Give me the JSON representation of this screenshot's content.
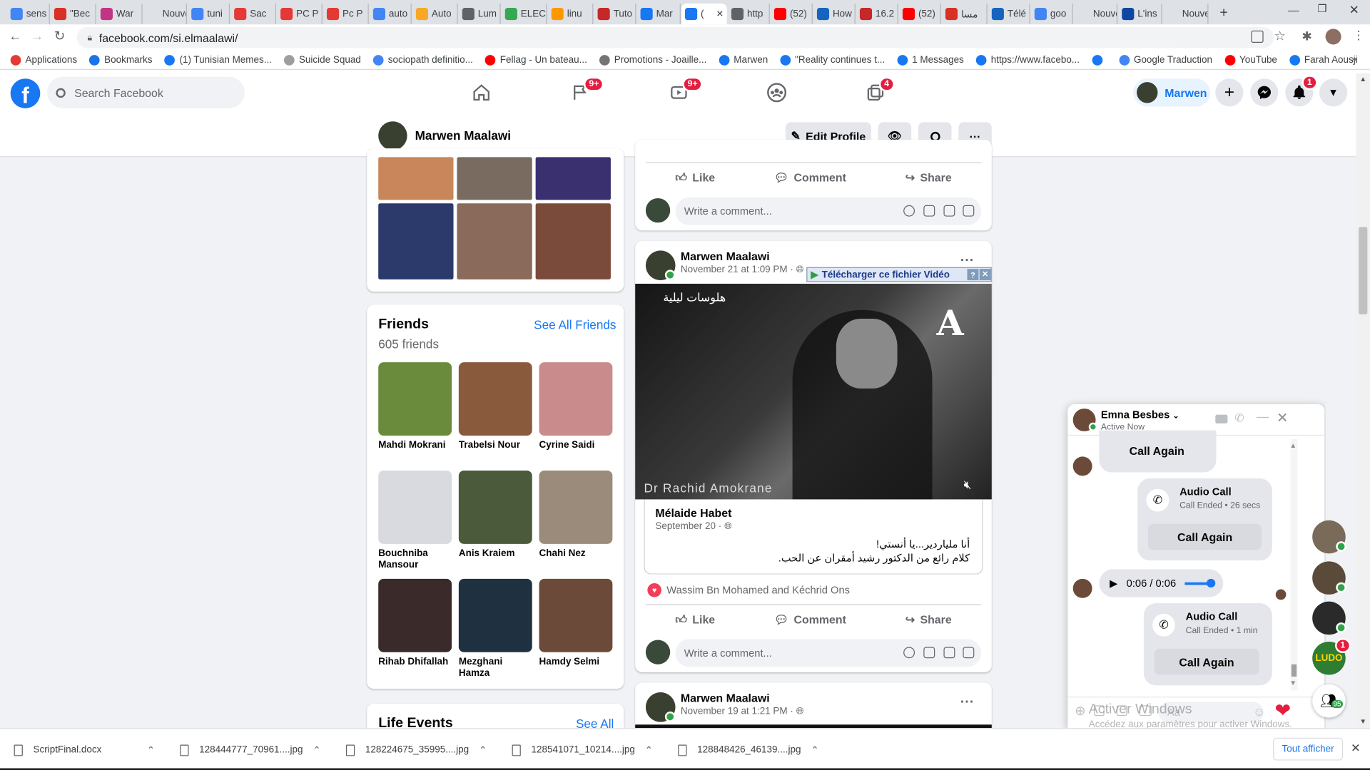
{
  "browser": {
    "tabs": [
      {
        "label": "sens",
        "icon": "google-icon",
        "color": "#4285f4"
      },
      {
        "label": "\"Bec",
        "icon": "heart-icon",
        "color": "#d93025"
      },
      {
        "label": "War",
        "icon": "instagram-icon",
        "color": "#c13584"
      },
      {
        "label": "Nouvel o",
        "icon": "none",
        "color": "#dee1e6"
      },
      {
        "label": "tuni",
        "icon": "google-icon",
        "color": "#4285f4"
      },
      {
        "label": "Sac",
        "icon": "avito-icon",
        "color": "#e53935"
      },
      {
        "label": "PC P",
        "icon": "avito-icon",
        "color": "#e53935"
      },
      {
        "label": "Pc P",
        "icon": "avito-icon",
        "color": "#e53935"
      },
      {
        "label": "auto",
        "icon": "google-icon",
        "color": "#4285f4"
      },
      {
        "label": "Auto",
        "icon": "chart-icon",
        "color": "#f9a825"
      },
      {
        "label": "Lum",
        "icon": "globe-icon",
        "color": "#5f6368"
      },
      {
        "label": "ELEC",
        "icon": "maps-icon",
        "color": "#34a853"
      },
      {
        "label": "linu",
        "icon": "page-icon",
        "color": "#ff9800"
      },
      {
        "label": "Tuto",
        "icon": "page-icon",
        "color": "#c62828"
      },
      {
        "label": "Mar",
        "icon": "facebook-icon",
        "color": "#1877f2"
      },
      {
        "label": "(",
        "icon": "facebook-icon",
        "color": "#1877f2"
      },
      {
        "label": "http",
        "icon": "globe-icon",
        "color": "#5f6368"
      },
      {
        "label": "(52)",
        "icon": "youtube-icon",
        "color": "#ff0000"
      },
      {
        "label": "How",
        "icon": "globe-icon",
        "color": "#1565c0"
      },
      {
        "label": "16.2",
        "icon": "cloud-icon",
        "color": "#c62828"
      },
      {
        "label": "(52)",
        "icon": "youtube-icon",
        "color": "#ff0000"
      },
      {
        "label": "مسا",
        "icon": "mail-icon",
        "color": "#d93025"
      },
      {
        "label": "Télé",
        "icon": "download-icon",
        "color": "#1565c0"
      },
      {
        "label": "goo",
        "icon": "google-icon",
        "color": "#4285f4"
      },
      {
        "label": "Nouvel o",
        "icon": "none",
        "color": "#dee1e6"
      },
      {
        "label": "L'ins",
        "icon": "globe-icon",
        "color": "#0d47a1"
      },
      {
        "label": "Nouvel o",
        "icon": "none",
        "color": "#dee1e6"
      }
    ],
    "url": "facebook.com/si.elmaalawi/",
    "bookmarks": [
      {
        "label": "Applications",
        "color": "#e53935"
      },
      {
        "label": "Bookmarks",
        "color": "#1a73e8"
      },
      {
        "label": "(1) Tunisian Memes...",
        "color": "#1877f2"
      },
      {
        "label": "Suicide Squad",
        "color": "#9e9e9e"
      },
      {
        "label": "sociopath definitio...",
        "color": "#4285f4"
      },
      {
        "label": "Fellag - Un bateau...",
        "color": "#ff0000"
      },
      {
        "label": "Promotions - Joaille...",
        "color": "#757575"
      },
      {
        "label": "Marwen",
        "color": "#1877f2"
      },
      {
        "label": "\"Reality continues t...",
        "color": "#1877f2"
      },
      {
        "label": "1 Messages",
        "color": "#1877f2"
      },
      {
        "label": "https://www.facebo...",
        "color": "#1877f2"
      },
      {
        "label": "",
        "color": "#1877f2"
      },
      {
        "label": "Google Traduction",
        "color": "#4285f4"
      },
      {
        "label": "YouTube",
        "color": "#ff0000"
      },
      {
        "label": "Farah Aousji",
        "color": "#1877f2"
      }
    ]
  },
  "header": {
    "search_placeholder": "Search Facebook",
    "badges": {
      "pages": "9+",
      "watch": "9+",
      "gaming": "4",
      "notifications": "1"
    },
    "profile_name": "Marwen"
  },
  "profile_bar": {
    "name": "Marwen Maalawi",
    "edit_label": "Edit Profile"
  },
  "friends": {
    "title": "Friends",
    "see_all": "See All Friends",
    "count": "605 friends",
    "list": [
      {
        "name": "Mahdi Mokrani",
        "color": "#6a8b3c"
      },
      {
        "name": "Trabelsi Nour",
        "color": "#8a5a3c"
      },
      {
        "name": "Cyrine Saidi",
        "color": "#c98b8b"
      },
      {
        "name": "Bouchniba Mansour",
        "color": "#d8dadf"
      },
      {
        "name": "Anis Kraiem",
        "color": "#4a5a3a"
      },
      {
        "name": "Chahi Nez",
        "color": "#9a8b7a"
      },
      {
        "name": "Rihab Dhifallah",
        "color": "#3a2a2a"
      },
      {
        "name": "Mezghani Hamza",
        "color": "#1f3040"
      },
      {
        "name": "Hamdy Selmi",
        "color": "#6b4a3a"
      }
    ]
  },
  "life_events": {
    "title": "Life Events",
    "see_all": "See All"
  },
  "actions": {
    "like": "Like",
    "comment": "Comment",
    "share": "Share",
    "write_comment": "Write a comment..."
  },
  "post1": {
    "author": "Marwen Maalawi",
    "date": "November 21 at 1:09 PM · ",
    "download_overlay": "Télécharger ce fichier Vidéo",
    "video_caption_ar": "هلوسات ليلية",
    "video_name": "Dr  Rachid Amokrane",
    "shared_author": "Mélaide Habet",
    "shared_date": "September 20 · ",
    "shared_line1": "أنا ملياردير...يا أنستي!",
    "shared_line2": "كلام رائع من  الدكتور رشيد أمقران عن الحب.",
    "reactions": "Wassim Bn Mohamed and Kéchrid Ons"
  },
  "post2": {
    "author": "Marwen Maalawi",
    "date": "November 19 at 1:21 PM · "
  },
  "messenger": {
    "name": "Emna Besbes",
    "status": "Active Now",
    "call_again": "Call Again",
    "call1_title": "Audio Call",
    "call1_sub": "Call Ended • 26 secs",
    "audio_time": "0:06 / 0:06",
    "call2_title": "Audio Call",
    "call2_sub": "Call Ended • 1 min"
  },
  "windows_watermark": {
    "line1": "Activer Windows",
    "line2": "Accédez aux paramètres pour activer Windows."
  },
  "contacts_badges": {
    "game": "1",
    "group_count": "95"
  },
  "downloads": {
    "items": [
      "ScriptFinal.docx",
      "128444777_70961....jpg",
      "128224675_35995....jpg",
      "128541071_10214....jpg",
      "128848426_46139....jpg"
    ],
    "show_all": "Tout afficher"
  }
}
